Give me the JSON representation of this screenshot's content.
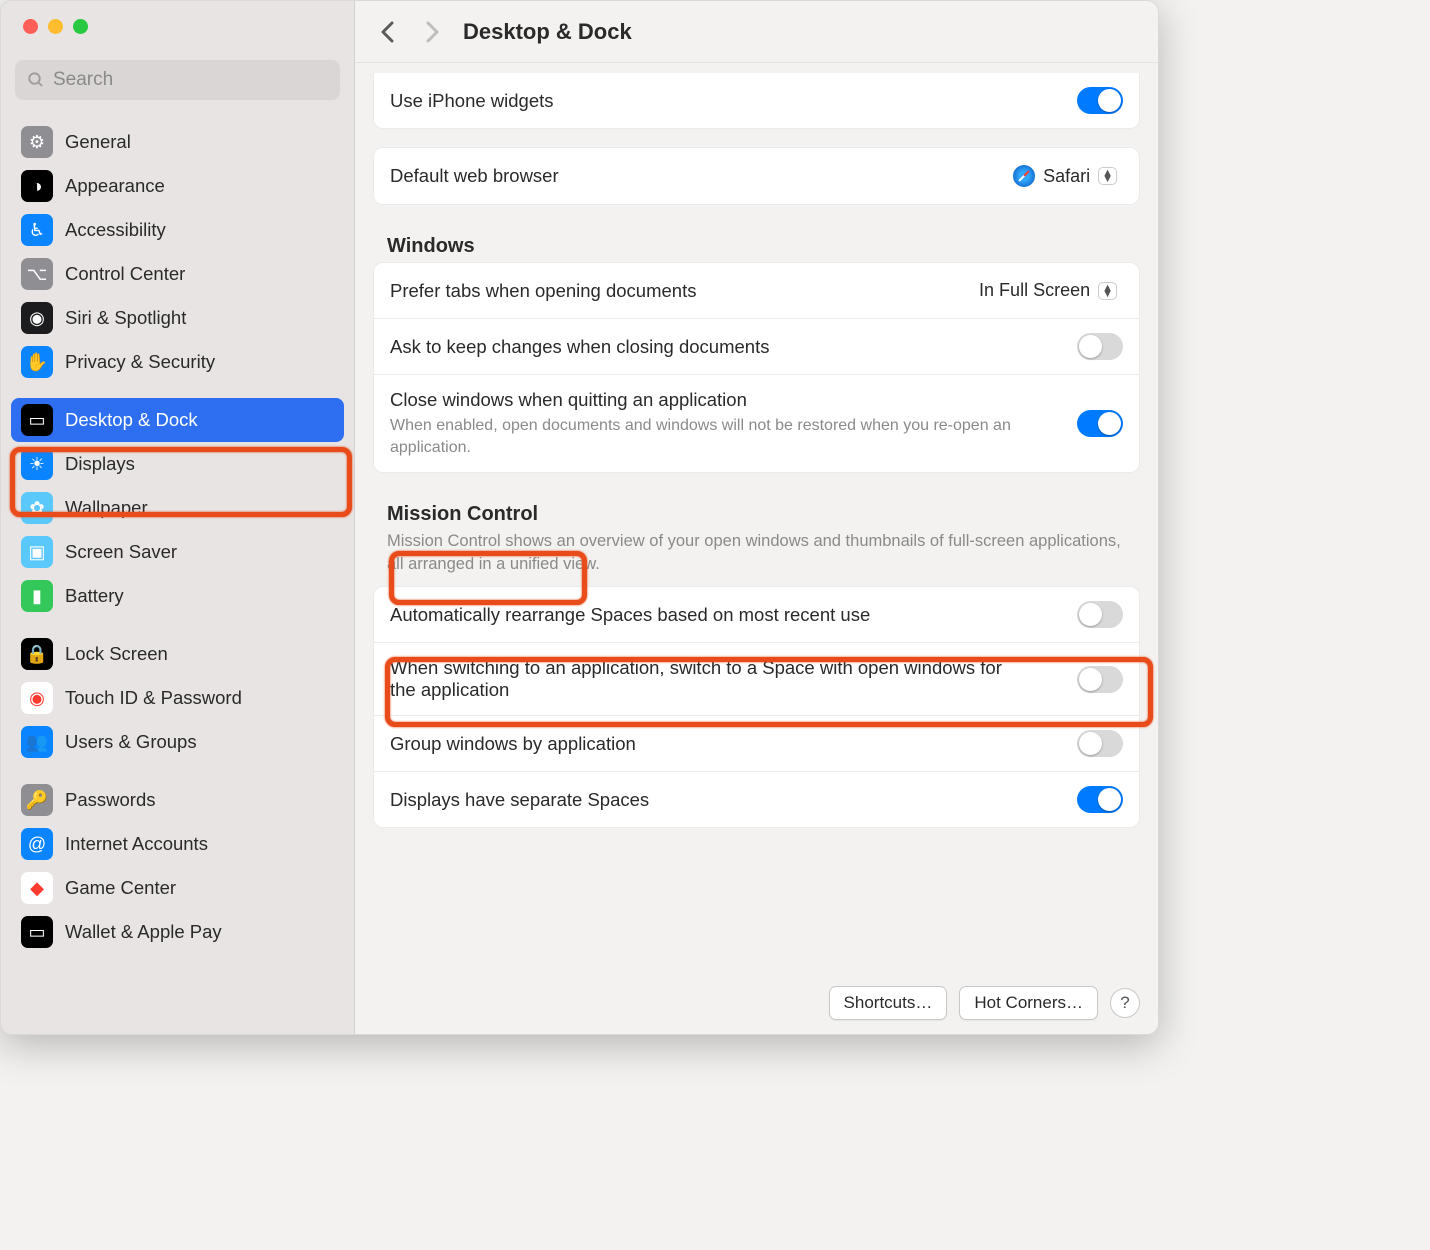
{
  "search": {
    "placeholder": "Search"
  },
  "title": "Desktop & Dock",
  "sidebar": {
    "groups": [
      [
        {
          "label": "General",
          "icon": "⚙︎",
          "bg": "#8e8e93"
        },
        {
          "label": "Appearance",
          "icon": "◑",
          "bg": "#000000"
        },
        {
          "label": "Accessibility",
          "icon": "♿︎",
          "bg": "#0a84ff"
        },
        {
          "label": "Control Center",
          "icon": "⌥",
          "bg": "#8e8e93"
        },
        {
          "label": "Siri & Spotlight",
          "icon": "◉",
          "bg": "#1c1c1e"
        },
        {
          "label": "Privacy & Security",
          "icon": "✋",
          "bg": "#0a84ff"
        }
      ],
      [
        {
          "label": "Desktop & Dock",
          "icon": "▭",
          "bg": "#000000",
          "selected": true
        },
        {
          "label": "Displays",
          "icon": "☀︎",
          "bg": "#0a84ff"
        },
        {
          "label": "Wallpaper",
          "icon": "✿",
          "bg": "#5ac8fa"
        },
        {
          "label": "Screen Saver",
          "icon": "▣",
          "bg": "#5ac8fa"
        },
        {
          "label": "Battery",
          "icon": "▮",
          "bg": "#34c759"
        }
      ],
      [
        {
          "label": "Lock Screen",
          "icon": "🔒",
          "bg": "#000000"
        },
        {
          "label": "Touch ID & Password",
          "icon": "◉",
          "bg": "#ffffff",
          "fg": "#ff3b30"
        },
        {
          "label": "Users & Groups",
          "icon": "👥",
          "bg": "#0a84ff"
        }
      ],
      [
        {
          "label": "Passwords",
          "icon": "🔑",
          "bg": "#8e8e93"
        },
        {
          "label": "Internet Accounts",
          "icon": "@",
          "bg": "#0a84ff"
        },
        {
          "label": "Game Center",
          "icon": "◆",
          "bg": "#ffffff",
          "fg": "#ff3b30"
        },
        {
          "label": "Wallet & Apple Pay",
          "icon": "▭",
          "bg": "#000000"
        }
      ]
    ]
  },
  "rows": {
    "iphone_widgets": "Use iPhone widgets",
    "default_browser": "Default web browser",
    "default_browser_value": "Safari",
    "windows_header": "Windows",
    "prefer_tabs": "Prefer tabs when opening documents",
    "prefer_tabs_value": "In Full Screen",
    "ask_keep": "Ask to keep changes when closing documents",
    "close_windows": "Close windows when quitting an application",
    "close_windows_sub": "When enabled, open documents and windows will not be restored when you re-open an application.",
    "mc_header": "Mission Control",
    "mc_desc": "Mission Control shows an overview of your open windows and thumbnails of full-screen applications, all arranged in a unified view.",
    "auto_rearrange": "Automatically rearrange Spaces based on most recent use",
    "switch_space": "When switching to an application, switch to a Space with open windows for the application",
    "group_windows": "Group windows by application",
    "sep_spaces": "Displays have separate Spaces"
  },
  "footer": {
    "shortcuts": "Shortcuts…",
    "hotcorners": "Hot Corners…"
  }
}
